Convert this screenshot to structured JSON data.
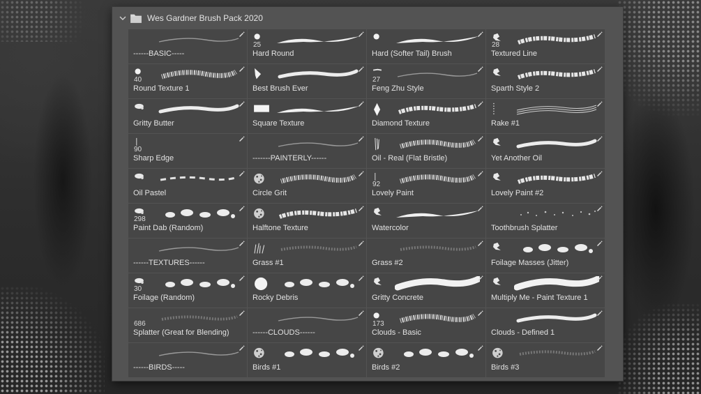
{
  "group": {
    "title": "Wes Gardner Brush Pack 2020"
  },
  "brushes": [
    {
      "label": "------BASIC-----",
      "size": "",
      "tip": "none",
      "stroke": "thin"
    },
    {
      "label": "Hard Round",
      "size": "25",
      "tip": "dot",
      "stroke": "taper"
    },
    {
      "label": "Hard (Softer Tail) Brush",
      "size": "",
      "tip": "dot",
      "stroke": "taper"
    },
    {
      "label": "Textured Line",
      "size": "28",
      "tip": "splat",
      "stroke": "textured"
    },
    {
      "label": "Round Texture 1",
      "size": "40",
      "tip": "dot",
      "stroke": "grainy"
    },
    {
      "label": "Best Brush Ever",
      "size": "",
      "tip": "shard",
      "stroke": "soft"
    },
    {
      "label": "Feng Zhu Style",
      "size": "27",
      "tip": "dash",
      "stroke": "thin"
    },
    {
      "label": "Sparth Style 2",
      "size": "",
      "tip": "splat",
      "stroke": "textured"
    },
    {
      "label": "Gritty Butter",
      "size": "",
      "tip": "blob",
      "stroke": "soft"
    },
    {
      "label": "Square Texture",
      "size": "",
      "tip": "rect",
      "stroke": "taper"
    },
    {
      "label": "Diamond Texture",
      "size": "",
      "tip": "diamond",
      "stroke": "textured"
    },
    {
      "label": "Rake #1",
      "size": "",
      "tip": "dotline",
      "stroke": "rake"
    },
    {
      "label": "Sharp Edge",
      "size": "90",
      "tip": "line",
      "stroke": "none"
    },
    {
      "label": "-------PAINTERLY------",
      "size": "",
      "tip": "none",
      "stroke": "thin"
    },
    {
      "label": "Oil - Real (Flat Bristle)",
      "size": "",
      "tip": "bristle",
      "stroke": "grainy"
    },
    {
      "label": "Yet Another Oil",
      "size": "",
      "tip": "splat",
      "stroke": "soft"
    },
    {
      "label": "Oil Pastel",
      "size": "",
      "tip": "blob",
      "stroke": "dashed"
    },
    {
      "label": "Circle Grit",
      "size": "",
      "tip": "grit",
      "stroke": "grainy"
    },
    {
      "label": "Lovely Paint",
      "size": "92",
      "tip": "line",
      "stroke": "grainy"
    },
    {
      "label": "Lovely Paint #2",
      "size": "",
      "tip": "splat",
      "stroke": "textured"
    },
    {
      "label": "Paint Dab (Random)",
      "size": "298",
      "tip": "blob",
      "stroke": "dabs"
    },
    {
      "label": "Halftone Texture",
      "size": "",
      "tip": "grit",
      "stroke": "textured"
    },
    {
      "label": "Watercolor",
      "size": "",
      "tip": "splat",
      "stroke": "taper"
    },
    {
      "label": "Toothbrush Splatter",
      "size": "",
      "tip": "none",
      "stroke": "splatter"
    },
    {
      "label": "------TEXTURES------",
      "size": "",
      "tip": "none",
      "stroke": "thin"
    },
    {
      "label": "Grass #1",
      "size": "",
      "tip": "grass",
      "stroke": "faint"
    },
    {
      "label": "Grass #2",
      "size": "",
      "tip": "none",
      "stroke": "faint"
    },
    {
      "label": "Foilage Masses (Jitter)",
      "size": "",
      "tip": "splat",
      "stroke": "dabs"
    },
    {
      "label": "Foilage (Random)",
      "size": "30",
      "tip": "blob",
      "stroke": "dabs"
    },
    {
      "label": "Rocky Debris",
      "size": "",
      "tip": "bigdot",
      "stroke": "dabs"
    },
    {
      "label": "Gritty Concrete",
      "size": "",
      "tip": "splat",
      "stroke": "wide"
    },
    {
      "label": "Multiply Me - Paint Texture 1",
      "size": "",
      "tip": "splat",
      "stroke": "wide"
    },
    {
      "label": "Splatter (Great for Blending)",
      "size": "686",
      "tip": "none",
      "stroke": "faint"
    },
    {
      "label": "------CLOUDS------",
      "size": "",
      "tip": "none",
      "stroke": "thin"
    },
    {
      "label": "Clouds - Basic",
      "size": "173",
      "tip": "dot",
      "stroke": "grainy"
    },
    {
      "label": "Clouds - Defined 1",
      "size": "",
      "tip": "none",
      "stroke": "soft"
    },
    {
      "label": "------BIRDS-----",
      "size": "",
      "tip": "none",
      "stroke": "thin"
    },
    {
      "label": "Birds #1",
      "size": "",
      "tip": "grit",
      "stroke": "dabs"
    },
    {
      "label": "Birds #2",
      "size": "",
      "tip": "grit",
      "stroke": "dabs"
    },
    {
      "label": "Birds #3",
      "size": "",
      "tip": "grit",
      "stroke": "faint"
    }
  ],
  "colors": {
    "panel": "#535353",
    "cell": "#464646",
    "text": "#e2e2e2"
  }
}
